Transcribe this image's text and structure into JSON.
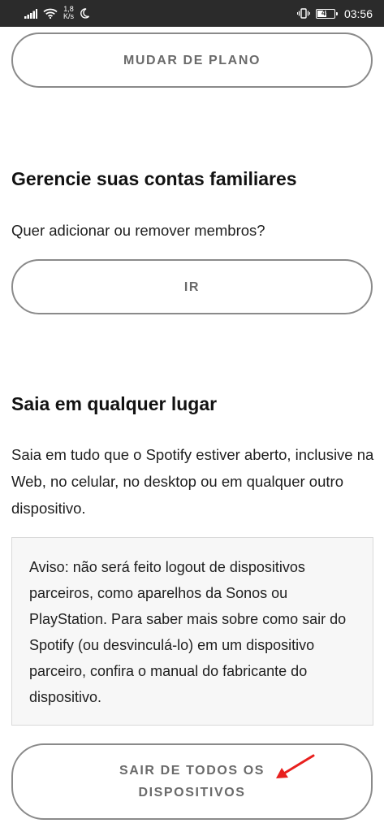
{
  "status_bar": {
    "net_speed_value": "1,8",
    "net_speed_unit": "K/s",
    "battery_level": "49",
    "battery_fraction": 0.49,
    "time": "03:56",
    "icons": [
      "signal-icon",
      "wifi-icon",
      "moon-icon",
      "vibrate-icon",
      "battery-icon"
    ]
  },
  "plan": {
    "change_plan_label": "MUDAR DE PLANO"
  },
  "family": {
    "title": "Gerencie suas contas familiares",
    "description": "Quer adicionar ou remover membros?",
    "go_label": "IR"
  },
  "signout": {
    "title": "Saia em qualquer lugar",
    "description": "Saia em tudo que o Spotify estiver aberto, inclusive na Web, no celular, no desktop ou em qualquer outro dispositivo.",
    "notice": "Aviso: não será feito logout de dispositivos parceiros, como aparelhos da Sonos ou PlayStation. Para saber mais sobre como sair do Spotify (ou desvinculá-lo) em um dispositivo parceiro, confira o manual do fabricante do dispositivo.",
    "logout_all_label": "SAIR DE TODOS OS DISPOSITIVOS"
  },
  "colors": {
    "status_bar_bg": "#2b2b2b",
    "button_border": "#8a8a8a",
    "button_text": "#6a6a6a",
    "notice_bg": "#f7f7f7",
    "annotation_arrow": "#e8201e"
  }
}
